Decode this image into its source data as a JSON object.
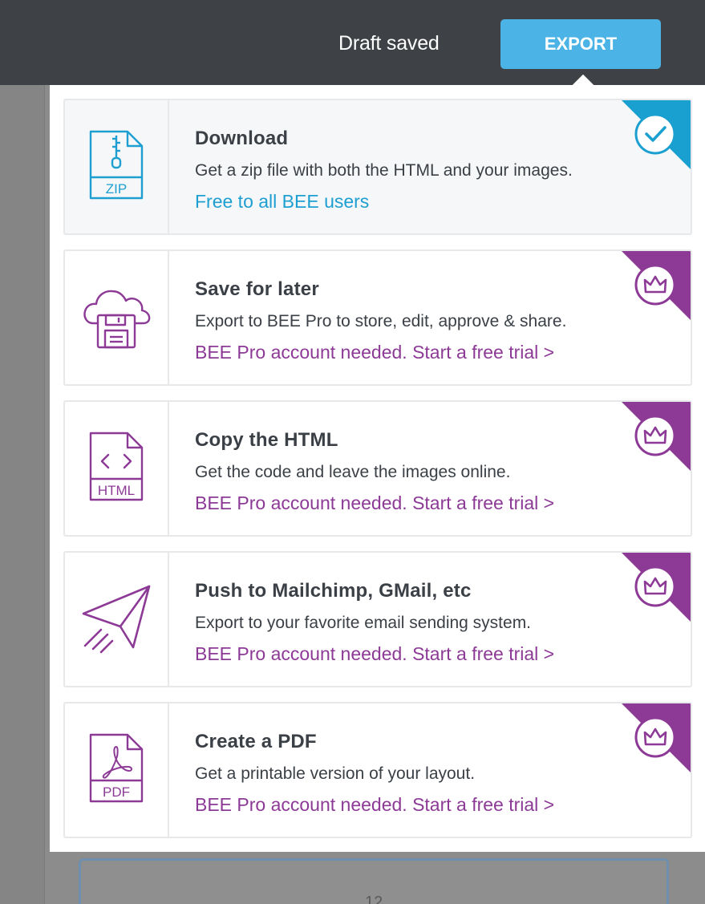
{
  "header": {
    "draft_status": "Draft saved",
    "export_label": "EXPORT"
  },
  "colors": {
    "topbar": "#3e4246",
    "export_button": "#4cb3e6",
    "free_accent": "#1e9fd1",
    "pro_accent": "#8c3a96",
    "text": "#3b4047"
  },
  "editor": {
    "block_number": "12"
  },
  "options": [
    {
      "title": "Download",
      "description": "Get a zip file with both the HTML and your images.",
      "link": "Free to all BEE users",
      "icon": "zip-file-icon",
      "icon_label": "ZIP",
      "badge": "check-icon",
      "selected": true
    },
    {
      "title": "Save for later",
      "description": "Export to BEE Pro to store, edit, approve & share.",
      "link": "BEE Pro account needed. Start a free trial >",
      "icon": "cloud-save-icon",
      "badge": "crown-icon"
    },
    {
      "title": "Copy the HTML",
      "description": "Get the code and leave the images online.",
      "link": "BEE Pro account needed. Start a free trial >",
      "icon": "html-file-icon",
      "icon_label": "HTML",
      "badge": "crown-icon"
    },
    {
      "title": "Push to Mailchimp, GMail, etc",
      "description": "Export to your favorite email sending system.",
      "link": "BEE Pro account needed. Start a free trial >",
      "icon": "paper-plane-icon",
      "badge": "crown-icon"
    },
    {
      "title": "Create a PDF",
      "description": "Get a printable version of your layout.",
      "link": "BEE Pro account needed. Start a free trial >",
      "icon": "pdf-file-icon",
      "icon_label": "PDF",
      "badge": "crown-icon"
    }
  ]
}
